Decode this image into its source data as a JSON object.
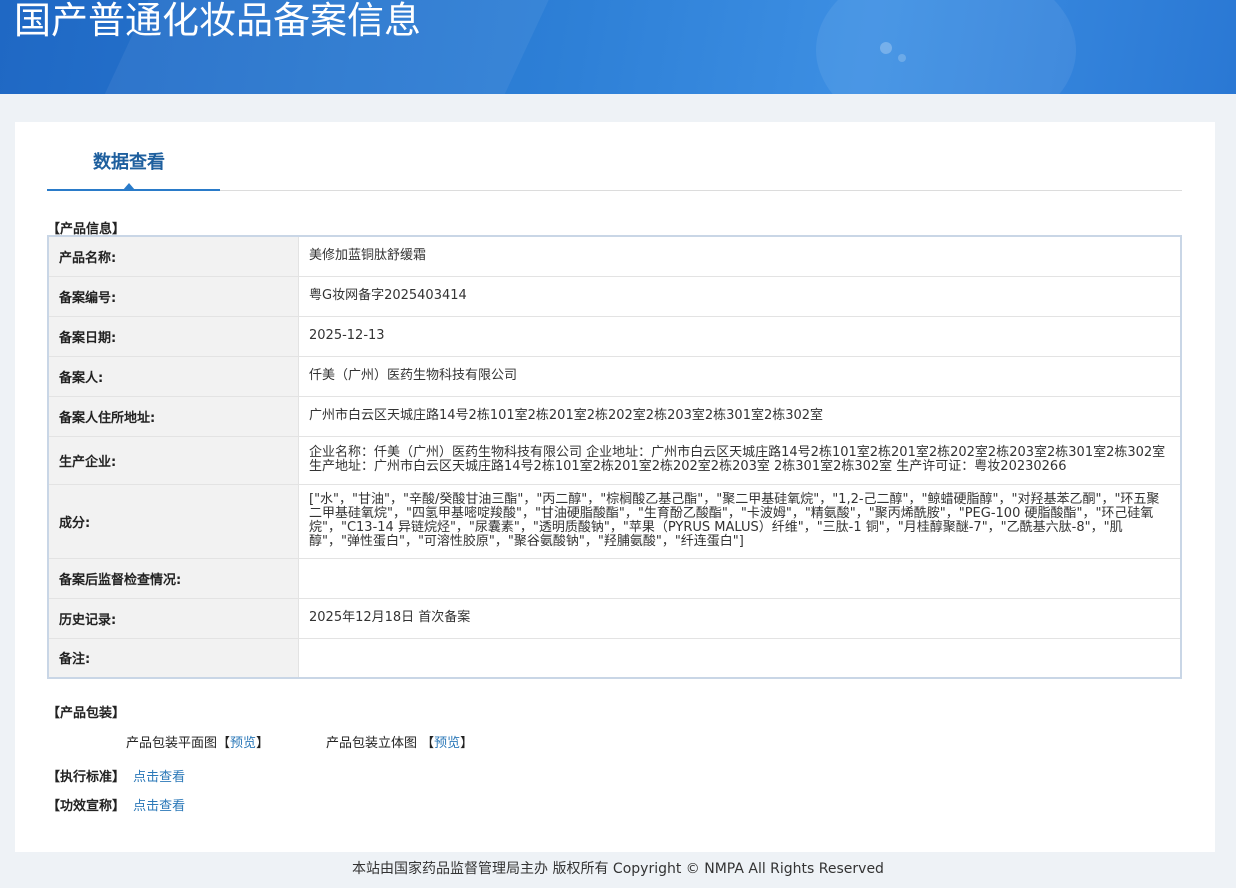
{
  "header": {
    "title": "国产普通化妆品备案信息"
  },
  "tab": {
    "label": "数据查看"
  },
  "sections": {
    "product_info": "【产品信息】",
    "product_package": "【产品包装】",
    "standard": "【执行标准】",
    "efficacy": "【功效宣称】"
  },
  "rows": [
    {
      "label": "产品名称:",
      "value": "美修加蓝铜肽舒缓霜"
    },
    {
      "label": "备案编号:",
      "value": "粤G妆网备字2025403414"
    },
    {
      "label": "备案日期:",
      "value": "2025-12-13"
    },
    {
      "label": "备案人:",
      "value": "仟美（广州）医药生物科技有限公司"
    },
    {
      "label": "备案人住所地址:",
      "value": "广州市白云区天城庄路14号2栋101室2栋201室2栋202室2栋203室2栋301室2栋302室"
    },
    {
      "label": "生产企业:",
      "value": "企业名称：仟美（广州）医药生物科技有限公司 企业地址：广州市白云区天城庄路14号2栋101室2栋201室2栋202室2栋203室2栋301室2栋302室 生产地址：广州市白云区天城庄路14号2栋101室2栋201室2栋202室2栋203室 2栋301室2栋302室 生产许可证：粤妆20230266"
    },
    {
      "label": "成分:",
      "value": "[\"水\"，\"甘油\"，\"辛酸/癸酸甘油三酯\"，\"丙二醇\"，\"棕榈酸乙基己酯\"，\"聚二甲基硅氧烷\"，\"1,2-己二醇\"，\"鲸蜡硬脂醇\"，\"对羟基苯乙酮\"，\"环五聚二甲基硅氧烷\"，\"四氢甲基嘧啶羧酸\"，\"甘油硬脂酸酯\"，\"生育酚乙酸酯\"，\"卡波姆\"，\"精氨酸\"，\"聚丙烯酰胺\"，\"PEG-100 硬脂酸酯\"，\"环己硅氧烷\"，\"C13-14 异链烷烃\"，\"尿囊素\"，\"透明质酸钠\"，\"苹果（PYRUS MALUS）纤维\"，\"三肽-1 铜\"，\"月桂醇聚醚-7\"，\"乙酰基六肽-8\"，\"肌醇\"，\"弹性蛋白\"，\"可溶性胶原\"，\"聚谷氨酸钠\"，\"羟脯氨酸\"，\"纤连蛋白\"]"
    },
    {
      "label": "备案后监督检查情况:",
      "value": ""
    },
    {
      "label": "历史记录:",
      "value": "2025年12月18日 首次备案"
    },
    {
      "label": "备注:",
      "value": ""
    }
  ],
  "package": {
    "flat_label": "产品包装平面图【",
    "flat_link": "预览",
    "flat_close": "】",
    "3d_label": "产品包装立体图 【",
    "3d_link": "预览",
    "3d_close": "】"
  },
  "links": {
    "standard_view": "点击查看",
    "efficacy_view": "点击查看"
  },
  "footer": {
    "text": "本站由国家药品监督管理局主办 版权所有 Copyright © NMPA All Rights Reserved"
  }
}
